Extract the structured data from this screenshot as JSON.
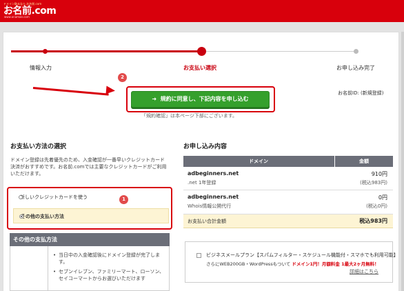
{
  "header": {
    "brand_color": "#d8000c",
    "logo_tagline": "ドメイン取るなら お名前.com",
    "logo_name": "お名前.com",
    "logo_url": "www.onamae.com"
  },
  "steps": [
    {
      "label": "情報入力",
      "state": "done"
    },
    {
      "label": "お支払い選択",
      "state": "current"
    },
    {
      "label": "お申し込み完了",
      "state": "upcoming"
    }
  ],
  "annotations": {
    "badge_1": "1",
    "badge_2": "2",
    "accent_color": "#d8000c"
  },
  "agree_button": {
    "icon": "arrow-right-icon",
    "label": "規約に同意し、下記内容を申し込む",
    "color": "#35a02c"
  },
  "agree_note": "「規約確認」は本ページ下部にございます。",
  "user_id_label": "お名前ID: (新規登録)",
  "payment": {
    "title": "お支払い方法の選択",
    "description": "ドメイン登録は先着優先のため、入金確認が一番早いクレジットカード決済がおすすめです。お名前.comでは主要なクレジットカードがご利用いただけます。",
    "options": [
      {
        "label": "新しいクレジットカードを使う",
        "selected": false
      },
      {
        "label": "その他の支払い方法",
        "selected": true
      }
    ],
    "other_title": "その他の支払方法",
    "other_items": [
      "当日中の入金確認後にドメイン登録が完了します。",
      "セブンイレブン、ファミリーマート、ローソン、セイコーマートからお選びいただけます"
    ]
  },
  "order": {
    "title": "お申し込み内容",
    "col_domain": "ドメイン",
    "col_amount": "金額",
    "rows": [
      {
        "name": "adbeginners.net",
        "sub": ".net 1年登録",
        "price": "910円",
        "tax": "(税込983円)"
      },
      {
        "name": "adbeginners.net",
        "sub": "Whois情報公開代行",
        "price": "0円",
        "tax": "(税込0円)"
      }
    ],
    "total_label": "お支払い合計金額",
    "total_value": "税込983円"
  },
  "business_mail": {
    "line1": "ビジネスメールプラン【スパムフィルター・スケジュール機能付・スマホでも利用可能】",
    "line2_prefix": "さらにWEB200GB・WordPressもついて",
    "line2_promo": "ドメイン1円！月額料金 1最大2ヶ月無料！",
    "link": "詳細はこちら"
  }
}
